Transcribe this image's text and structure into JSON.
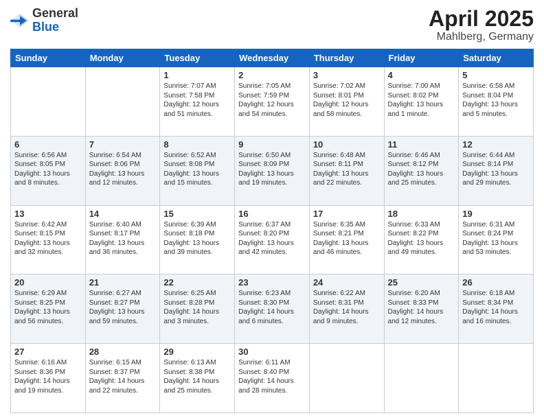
{
  "header": {
    "logo_line1": "General",
    "logo_line2": "Blue",
    "month": "April 2025",
    "location": "Mahlberg, Germany"
  },
  "weekdays": [
    "Sunday",
    "Monday",
    "Tuesday",
    "Wednesday",
    "Thursday",
    "Friday",
    "Saturday"
  ],
  "weeks": [
    [
      {
        "day": "",
        "info": ""
      },
      {
        "day": "",
        "info": ""
      },
      {
        "day": "1",
        "info": "Sunrise: 7:07 AM\nSunset: 7:58 PM\nDaylight: 12 hours and 51 minutes."
      },
      {
        "day": "2",
        "info": "Sunrise: 7:05 AM\nSunset: 7:59 PM\nDaylight: 12 hours and 54 minutes."
      },
      {
        "day": "3",
        "info": "Sunrise: 7:02 AM\nSunset: 8:01 PM\nDaylight: 12 hours and 58 minutes."
      },
      {
        "day": "4",
        "info": "Sunrise: 7:00 AM\nSunset: 8:02 PM\nDaylight: 13 hours and 1 minute."
      },
      {
        "day": "5",
        "info": "Sunrise: 6:58 AM\nSunset: 8:04 PM\nDaylight: 13 hours and 5 minutes."
      }
    ],
    [
      {
        "day": "6",
        "info": "Sunrise: 6:56 AM\nSunset: 8:05 PM\nDaylight: 13 hours and 8 minutes."
      },
      {
        "day": "7",
        "info": "Sunrise: 6:54 AM\nSunset: 8:06 PM\nDaylight: 13 hours and 12 minutes."
      },
      {
        "day": "8",
        "info": "Sunrise: 6:52 AM\nSunset: 8:08 PM\nDaylight: 13 hours and 15 minutes."
      },
      {
        "day": "9",
        "info": "Sunrise: 6:50 AM\nSunset: 8:09 PM\nDaylight: 13 hours and 19 minutes."
      },
      {
        "day": "10",
        "info": "Sunrise: 6:48 AM\nSunset: 8:11 PM\nDaylight: 13 hours and 22 minutes."
      },
      {
        "day": "11",
        "info": "Sunrise: 6:46 AM\nSunset: 8:12 PM\nDaylight: 13 hours and 25 minutes."
      },
      {
        "day": "12",
        "info": "Sunrise: 6:44 AM\nSunset: 8:14 PM\nDaylight: 13 hours and 29 minutes."
      }
    ],
    [
      {
        "day": "13",
        "info": "Sunrise: 6:42 AM\nSunset: 8:15 PM\nDaylight: 13 hours and 32 minutes."
      },
      {
        "day": "14",
        "info": "Sunrise: 6:40 AM\nSunset: 8:17 PM\nDaylight: 13 hours and 36 minutes."
      },
      {
        "day": "15",
        "info": "Sunrise: 6:39 AM\nSunset: 8:18 PM\nDaylight: 13 hours and 39 minutes."
      },
      {
        "day": "16",
        "info": "Sunrise: 6:37 AM\nSunset: 8:20 PM\nDaylight: 13 hours and 42 minutes."
      },
      {
        "day": "17",
        "info": "Sunrise: 6:35 AM\nSunset: 8:21 PM\nDaylight: 13 hours and 46 minutes."
      },
      {
        "day": "18",
        "info": "Sunrise: 6:33 AM\nSunset: 8:22 PM\nDaylight: 13 hours and 49 minutes."
      },
      {
        "day": "19",
        "info": "Sunrise: 6:31 AM\nSunset: 8:24 PM\nDaylight: 13 hours and 53 minutes."
      }
    ],
    [
      {
        "day": "20",
        "info": "Sunrise: 6:29 AM\nSunset: 8:25 PM\nDaylight: 13 hours and 56 minutes."
      },
      {
        "day": "21",
        "info": "Sunrise: 6:27 AM\nSunset: 8:27 PM\nDaylight: 13 hours and 59 minutes."
      },
      {
        "day": "22",
        "info": "Sunrise: 6:25 AM\nSunset: 8:28 PM\nDaylight: 14 hours and 3 minutes."
      },
      {
        "day": "23",
        "info": "Sunrise: 6:23 AM\nSunset: 8:30 PM\nDaylight: 14 hours and 6 minutes."
      },
      {
        "day": "24",
        "info": "Sunrise: 6:22 AM\nSunset: 8:31 PM\nDaylight: 14 hours and 9 minutes."
      },
      {
        "day": "25",
        "info": "Sunrise: 6:20 AM\nSunset: 8:33 PM\nDaylight: 14 hours and 12 minutes."
      },
      {
        "day": "26",
        "info": "Sunrise: 6:18 AM\nSunset: 8:34 PM\nDaylight: 14 hours and 16 minutes."
      }
    ],
    [
      {
        "day": "27",
        "info": "Sunrise: 6:16 AM\nSunset: 8:36 PM\nDaylight: 14 hours and 19 minutes."
      },
      {
        "day": "28",
        "info": "Sunrise: 6:15 AM\nSunset: 8:37 PM\nDaylight: 14 hours and 22 minutes."
      },
      {
        "day": "29",
        "info": "Sunrise: 6:13 AM\nSunset: 8:38 PM\nDaylight: 14 hours and 25 minutes."
      },
      {
        "day": "30",
        "info": "Sunrise: 6:11 AM\nSunset: 8:40 PM\nDaylight: 14 hours and 28 minutes."
      },
      {
        "day": "",
        "info": ""
      },
      {
        "day": "",
        "info": ""
      },
      {
        "day": "",
        "info": ""
      }
    ]
  ]
}
